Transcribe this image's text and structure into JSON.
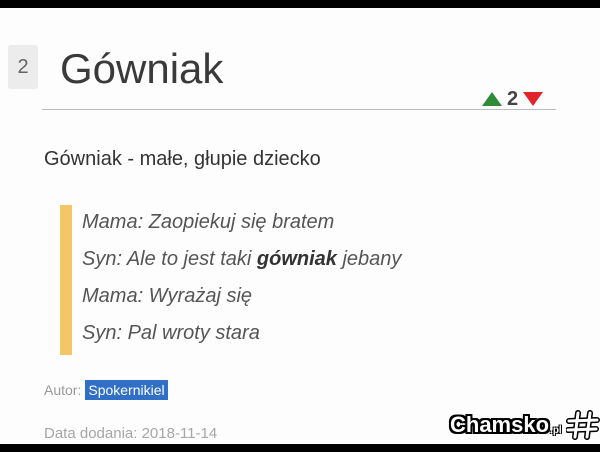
{
  "entry": {
    "rank": "2",
    "title": "Gówniak",
    "votes": {
      "count": "2",
      "up_icon": "triangle-up-icon",
      "down_icon": "triangle-down-icon",
      "up_color": "#2e8b3a",
      "down_color": "#e0242a"
    },
    "definition": "Gówniak - małe, głupie dziecko",
    "example": {
      "lines": [
        {
          "before": "Mama: Zaopiekuj się bratem"
        },
        {
          "before": "Syn: Ale to jest taki ",
          "bold": "gówniak",
          "after": " jebany"
        },
        {
          "before": "Mama: Wyrażaj się"
        },
        {
          "before": "Syn: Pal wroty stara"
        }
      ],
      "accent_color": "#f3c765"
    },
    "author_label": "Autor:",
    "author_name": "Spokernikiel",
    "date_label": "Data dodania: 2018-11-14"
  },
  "watermark": {
    "text": "Chamsko",
    "suffix": ".pl",
    "icon": "hash-icon"
  }
}
